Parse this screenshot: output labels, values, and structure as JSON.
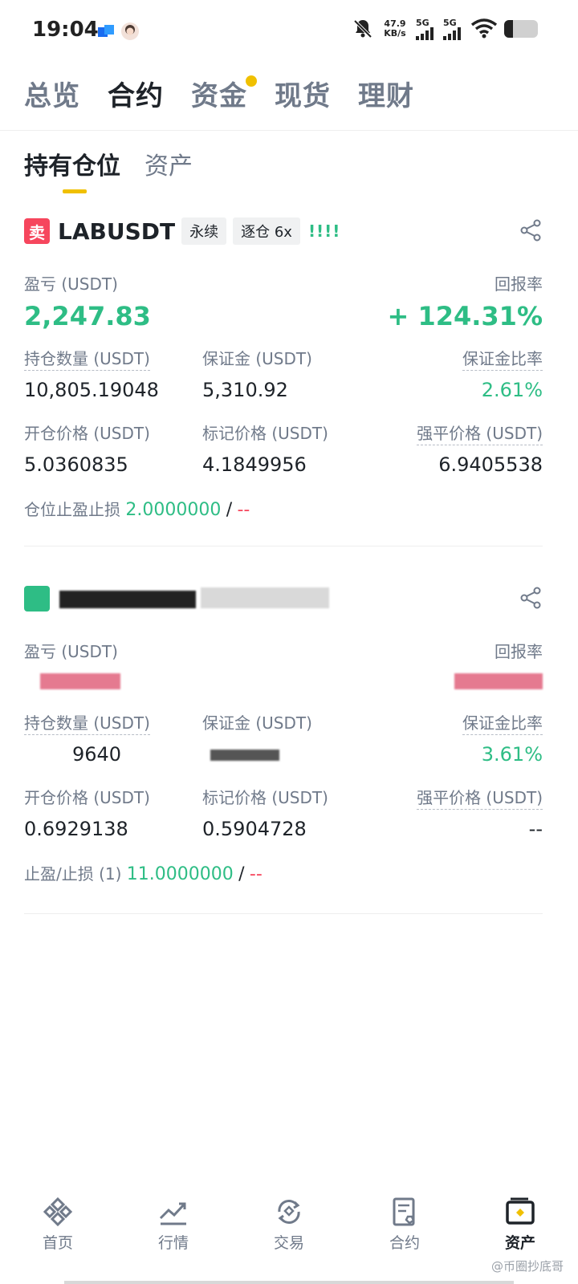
{
  "status_bar": {
    "time": "19:04",
    "net_speed": "47.9",
    "net_unit": "KB/s",
    "sig1": "5G",
    "sig2": "5G",
    "battery_level": 0.25
  },
  "top_tabs": [
    {
      "label": "总览",
      "active": false
    },
    {
      "label": "合约",
      "active": true
    },
    {
      "label": "资金",
      "active": false,
      "dot": true
    },
    {
      "label": "现货",
      "active": false
    },
    {
      "label": "理财",
      "active": false
    }
  ],
  "sub_tabs": [
    {
      "label": "持有仓位",
      "active": true
    },
    {
      "label": "资产",
      "active": false
    }
  ],
  "positions": [
    {
      "side": "卖",
      "symbol": "LABUSDT",
      "tags": [
        "永续",
        "逐仓 6x"
      ],
      "leverage_marks": "!!!!",
      "pnl_label": "盈亏 (USDT)",
      "pnl": "2,247.83",
      "roe_label": "回报率",
      "roe": "+ 124.31%",
      "size_label": "持仓数量 (USDT)",
      "size": "10,805.19048",
      "margin_label": "保证金 (USDT)",
      "margin": "5,310.92",
      "margin_ratio_label": "保证金比率",
      "margin_ratio": "2.61%",
      "entry_label": "开仓价格 (USDT)",
      "entry": "5.0360835",
      "mark_label": "标记价格 (USDT)",
      "mark": "4.1849956",
      "liq_label": "强平价格 (USDT)",
      "liq": "6.9405538",
      "tpsl_label": "仓位止盈止损",
      "tpsl_tp": "2.0000000",
      "tpsl_sep": "/",
      "tpsl_sl": "--"
    },
    {
      "pnl_label": "盈亏 (USDT)",
      "roe_label": "回报率",
      "size_label": "持仓数量 (USDT)",
      "size_partial": "9640",
      "margin_label": "保证金 (USDT)",
      "margin_ratio_label": "保证金比率",
      "margin_ratio": "3.61%",
      "entry_label": "开仓价格 (USDT)",
      "entry": "0.6929138",
      "mark_label": "标记价格 (USDT)",
      "mark": "0.5904728",
      "liq_label": "强平价格 (USDT)",
      "liq": "--",
      "tpsl_label": "止盈/止损 (1)",
      "tpsl_tp": "11.0000000",
      "tpsl_sep": "/",
      "tpsl_sl": "--"
    }
  ],
  "bottom_nav": [
    {
      "label": "首页",
      "icon": "home-icon",
      "active": false
    },
    {
      "label": "行情",
      "icon": "market-chart-icon",
      "active": false
    },
    {
      "label": "交易",
      "icon": "trade-exchange-icon",
      "active": false
    },
    {
      "label": "合约",
      "icon": "futures-doc-icon",
      "active": false
    },
    {
      "label": "资产",
      "icon": "wallet-icon",
      "active": true
    }
  ],
  "watermark": "@币圈抄底哥",
  "colors": {
    "green": "#2ebd85",
    "red": "#f6465d",
    "yellow": "#f0c000",
    "text": "#1e2329",
    "muted": "#707a8a"
  }
}
